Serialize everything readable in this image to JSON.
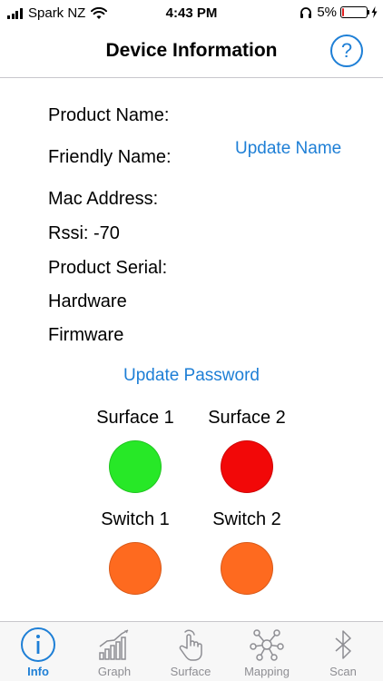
{
  "status_bar": {
    "carrier": "Spark NZ",
    "time": "4:43 PM",
    "battery_percent": "5%",
    "battery_level": 0.05,
    "icons": [
      "signal-icon",
      "wifi-icon",
      "headphones-icon",
      "battery-icon",
      "charging-bolt-icon"
    ]
  },
  "nav": {
    "title": "Device Information",
    "help_label": "?"
  },
  "info": {
    "product_name": "Product Name:",
    "friendly_name": "Friendly Name:",
    "mac_address": "Mac Address:",
    "rssi": "Rssi: -70",
    "product_serial": "Product Serial:",
    "hardware": "Hardware",
    "firmware": "Firmware"
  },
  "actions": {
    "update_name": "Update Name",
    "update_password": "Update Password"
  },
  "indicators": [
    {
      "label": "Surface 1",
      "color": "#27e827"
    },
    {
      "label": "Surface 2",
      "color": "#f20808"
    },
    {
      "label": "Switch 1",
      "color": "#fe6a1f"
    },
    {
      "label": "Switch 2",
      "color": "#fe6a1f"
    }
  ],
  "tabs": [
    {
      "label": "Info",
      "icon": "info-icon",
      "active": true
    },
    {
      "label": "Graph",
      "icon": "graph-icon",
      "active": false
    },
    {
      "label": "Surface",
      "icon": "touch-icon",
      "active": false
    },
    {
      "label": "Mapping",
      "icon": "network-icon",
      "active": false
    },
    {
      "label": "Scan",
      "icon": "bluetooth-icon",
      "active": false
    }
  ],
  "colors": {
    "accent": "#1e7fd6",
    "tab_inactive": "#8e8e93"
  }
}
